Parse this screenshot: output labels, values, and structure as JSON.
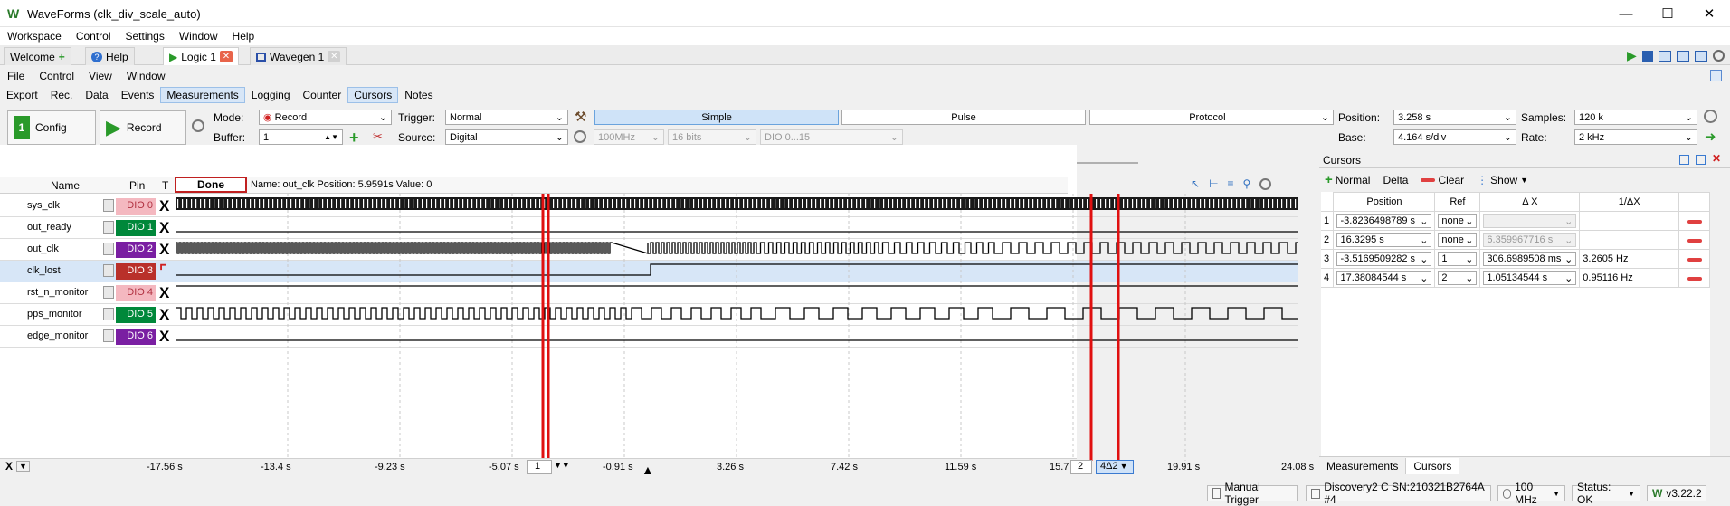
{
  "window": {
    "title": "WaveForms (clk_div_scale_auto)"
  },
  "menu": [
    "Workspace",
    "Control",
    "Settings",
    "Window",
    "Help"
  ],
  "doc_tabs": [
    {
      "label": "Welcome"
    },
    {
      "label": "Help"
    },
    {
      "label": "Logic 1"
    },
    {
      "label": "Wavegen 1"
    }
  ],
  "submenu": [
    "File",
    "Control",
    "View",
    "Window"
  ],
  "toolbar2": [
    "Export",
    "Rec.",
    "Data",
    "Events",
    "Measurements",
    "Logging",
    "Counter",
    "Cursors",
    "Notes"
  ],
  "controls": {
    "config_label": "Config",
    "record_label": "Record",
    "mode_label": "Mode:",
    "mode_value": "Record",
    "buffer_label": "Buffer:",
    "buffer_value": "1",
    "trigger_label": "Trigger:",
    "trigger_value": "Normal",
    "source_label": "Source:",
    "source_value": "Digital",
    "rate_sel": "100MHz",
    "bits_sel": "16 bits",
    "dio_sel": "DIO 0...15",
    "simple": "Simple",
    "pulse": "Pulse",
    "protocol": "Protocol",
    "position_label": "Position:",
    "position_value": "3.258 s",
    "base_label": "Base:",
    "base_value": "4.164 s/div",
    "samples_label": "Samples:",
    "samples_value": "120 k",
    "rate_label": "Rate:",
    "rate_value": "2 kHz"
  },
  "wave": {
    "col_name": "Name",
    "col_pin": "Pin",
    "col_t": "T",
    "status": "Done",
    "info": "Name: out_clk  Position: 5.9591s  Value: 0",
    "signals": [
      {
        "name": "sys_clk",
        "pin": "DIO 0",
        "color": "#f4b8c0"
      },
      {
        "name": "out_ready",
        "pin": "DIO 1",
        "color": "#00883a"
      },
      {
        "name": "out_clk",
        "pin": "DIO 2",
        "color": "#7a1fa2"
      },
      {
        "name": "clk_lost",
        "pin": "DIO 3",
        "color": "#b9302a"
      },
      {
        "name": "rst_n_monitor",
        "pin": "DIO 4",
        "color": "#f4b8c0"
      },
      {
        "name": "pps_monitor",
        "pin": "DIO 5",
        "color": "#00883a"
      },
      {
        "name": "edge_monitor",
        "pin": "DIO 6",
        "color": "#7a1fa2"
      }
    ],
    "x_label": "X",
    "axis_ticks": [
      "-17.56 s",
      "-13.4 s",
      "-9.23 s",
      "-5.07 s",
      "-0.91 s",
      "3.26 s",
      "7.42 s",
      "11.59 s",
      "15.7",
      "19.91 s",
      "24.08 s"
    ],
    "cursor_box1": "1",
    "cursor_box2": "2",
    "cursor_box3": "4Δ2"
  },
  "cursors_panel": {
    "title": "Cursors",
    "normal": "Normal",
    "delta": "Delta",
    "clear": "Clear",
    "show": "Show",
    "headers": [
      "Position",
      "Ref",
      "Δ X",
      "1/ΔX"
    ],
    "rows": [
      {
        "n": "1",
        "pos": "-3.8236498789 s",
        "ref": "none",
        "dx": "",
        "inv": "",
        "dx_disabled": true
      },
      {
        "n": "2",
        "pos": "16.3295 s",
        "ref": "none",
        "dx": "6.359967716 s",
        "inv": "",
        "dx_disabled": true
      },
      {
        "n": "3",
        "pos": "-3.5169509282 s",
        "ref": "1",
        "dx": "306.6989508 ms",
        "inv": "3.2605 Hz",
        "dx_disabled": false
      },
      {
        "n": "4",
        "pos": "17.38084544 s",
        "ref": "2",
        "dx": "1.05134544 s",
        "inv": "0.95116 Hz",
        "dx_disabled": false
      }
    ],
    "bottom_tabs": [
      "Measurements",
      "Cursors"
    ]
  },
  "status": {
    "manual_trigger": "Manual Trigger",
    "device": "Discovery2 C SN:210321B2764A #4",
    "clock": "100 MHz",
    "status": "Status: OK",
    "version": "v3.22.2"
  }
}
